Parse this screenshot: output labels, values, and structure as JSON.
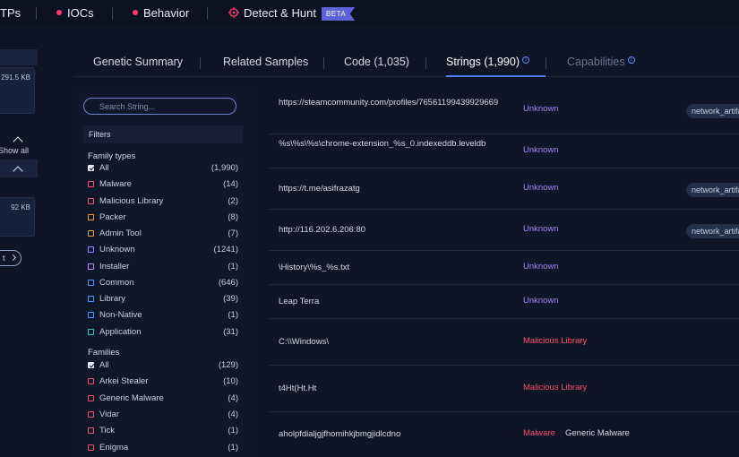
{
  "topnav": {
    "ttps_label": "TPs",
    "iocs_label": "IOCs",
    "behavior_label": "Behavior",
    "detect_label": "Detect & Hunt",
    "beta_label": "BETA"
  },
  "left_panel": {
    "size1": "291.5 KB",
    "show_all": "Show all",
    "size2": "92 KB",
    "pill_text": "t"
  },
  "tabs": [
    {
      "label": "Genetic Summary"
    },
    {
      "label": "Related Samples"
    },
    {
      "label": "Code (1,035)"
    },
    {
      "label": "Strings (1,990)"
    },
    {
      "label": "Capabilities"
    }
  ],
  "colors": {
    "accent": "#4e7bff",
    "unknown": "#a784ff",
    "malicious": "#ff4d6d",
    "background": "#0d1526"
  },
  "sidebar": {
    "search_placeholder": "Search String...",
    "filters_label": "Filters",
    "family_types_title": "Family types",
    "family_types": [
      {
        "label": "All",
        "count": "(1,990)",
        "checked": true,
        "color": "#e6ebf5"
      },
      {
        "label": "Malware",
        "count": "(14)",
        "checked": false,
        "color": "#ff4d6d"
      },
      {
        "label": "Malicious Library",
        "count": "(2)",
        "checked": false,
        "color": "#ff4d6d"
      },
      {
        "label": "Packer",
        "count": "(8)",
        "checked": false,
        "color": "#f0a030"
      },
      {
        "label": "Admin Tool",
        "count": "(7)",
        "checked": false,
        "color": "#f0a030"
      },
      {
        "label": "Unknown",
        "count": "(1241)",
        "checked": false,
        "color": "#a784ff"
      },
      {
        "label": "Installer",
        "count": "(1)",
        "checked": false,
        "color": "#c88cf0"
      },
      {
        "label": "Common",
        "count": "(646)",
        "checked": false,
        "color": "#4e9bff"
      },
      {
        "label": "Library",
        "count": "(39)",
        "checked": false,
        "color": "#4e9bff"
      },
      {
        "label": "Non-Native",
        "count": "(1)",
        "checked": false,
        "color": "#4e9bff"
      },
      {
        "label": "Application",
        "count": "(31)",
        "checked": false,
        "color": "#3cc8c8"
      }
    ],
    "families_title": "Families",
    "families": [
      {
        "label": "All",
        "count": "(129)",
        "checked": true,
        "color": "#e6ebf5"
      },
      {
        "label": "Arkei Stealer",
        "count": "(10)",
        "checked": false,
        "color": "#ff4d6d"
      },
      {
        "label": "Generic Malware",
        "count": "(4)",
        "checked": false,
        "color": "#ff4d6d"
      },
      {
        "label": "Vidar",
        "count": "(4)",
        "checked": false,
        "color": "#ff4d6d"
      },
      {
        "label": "Tick",
        "count": "(1)",
        "checked": false,
        "color": "#ff4d6d"
      },
      {
        "label": "Enigma",
        "count": "(1)",
        "checked": false,
        "color": "#ff4d6d"
      }
    ]
  },
  "strings": [
    {
      "value": "https://steamcommunity.com/profiles/76561199439929669",
      "type": "Unknown",
      "type_class": "unknown",
      "family": "",
      "tag": "network_artifact"
    },
    {
      "value": "%s\\%s\\%s\\chrome-extension_%s_0.indexeddb.leveldb",
      "type": "Unknown",
      "type_class": "unknown",
      "family": "",
      "tag": ""
    },
    {
      "value": "https://t.me/asifrazatg",
      "type": "Unknown",
      "type_class": "unknown",
      "family": "",
      "tag": "network_artifact"
    },
    {
      "value": "http://116.202.6.206:80",
      "type": "Unknown",
      "type_class": "unknown",
      "family": "",
      "tag": "network_artifact"
    },
    {
      "value": "\\History\\%s_%s.txt",
      "type": "Unknown",
      "type_class": "unknown",
      "family": "",
      "tag": ""
    },
    {
      "value": "Leap Terra",
      "type": "Unknown",
      "type_class": "unknown",
      "family": "",
      "tag": ""
    },
    {
      "value": "C:\\\\Windows\\",
      "type": "Malicious Library",
      "type_class": "mal",
      "family": "",
      "tag": ""
    },
    {
      "value": "t4Ht(Ht.Ht",
      "type": "Malicious Library",
      "type_class": "mal",
      "family": "",
      "tag": ""
    },
    {
      "value": "aholpfdialjgjfhomihkjbmgjidlcdno",
      "type": "Malware",
      "type_class": "mal",
      "family": "Generic Malware",
      "tag": ""
    }
  ]
}
